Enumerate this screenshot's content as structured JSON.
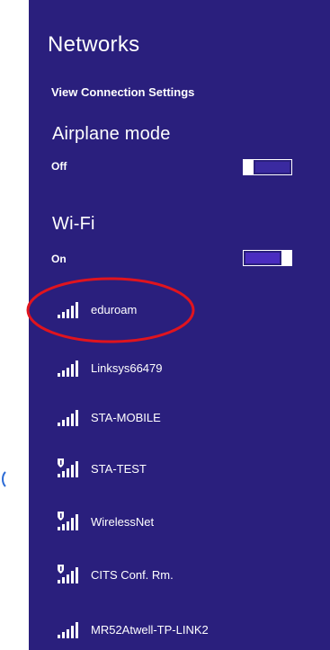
{
  "panel": {
    "title": "Networks",
    "view_settings_link": "View Connection Settings",
    "background": "#2a1f7d"
  },
  "airplane": {
    "title": "Airplane mode",
    "state": "Off"
  },
  "wifi": {
    "title": "Wi-Fi",
    "state": "On"
  },
  "networks": [
    {
      "name": "eduroam",
      "secured": false,
      "icon": "wifi-signal-icon"
    },
    {
      "name": "Linksys66479",
      "secured": false,
      "icon": "wifi-signal-icon"
    },
    {
      "name": "STA-MOBILE",
      "secured": false,
      "icon": "wifi-signal-icon"
    },
    {
      "name": "STA-TEST",
      "secured": true,
      "icon": "wifi-secured-icon"
    },
    {
      "name": "WirelessNet",
      "secured": true,
      "icon": "wifi-secured-icon"
    },
    {
      "name": "CITS Conf. Rm.",
      "secured": true,
      "icon": "wifi-secured-icon"
    },
    {
      "name": "MR52Atwell-TP-LINK2",
      "secured": false,
      "icon": "wifi-signal-icon"
    }
  ],
  "colors": {
    "accent": "#4a2cc0",
    "highlight_circle": "#e0141e",
    "panel_bg": "#2a1f7d"
  }
}
